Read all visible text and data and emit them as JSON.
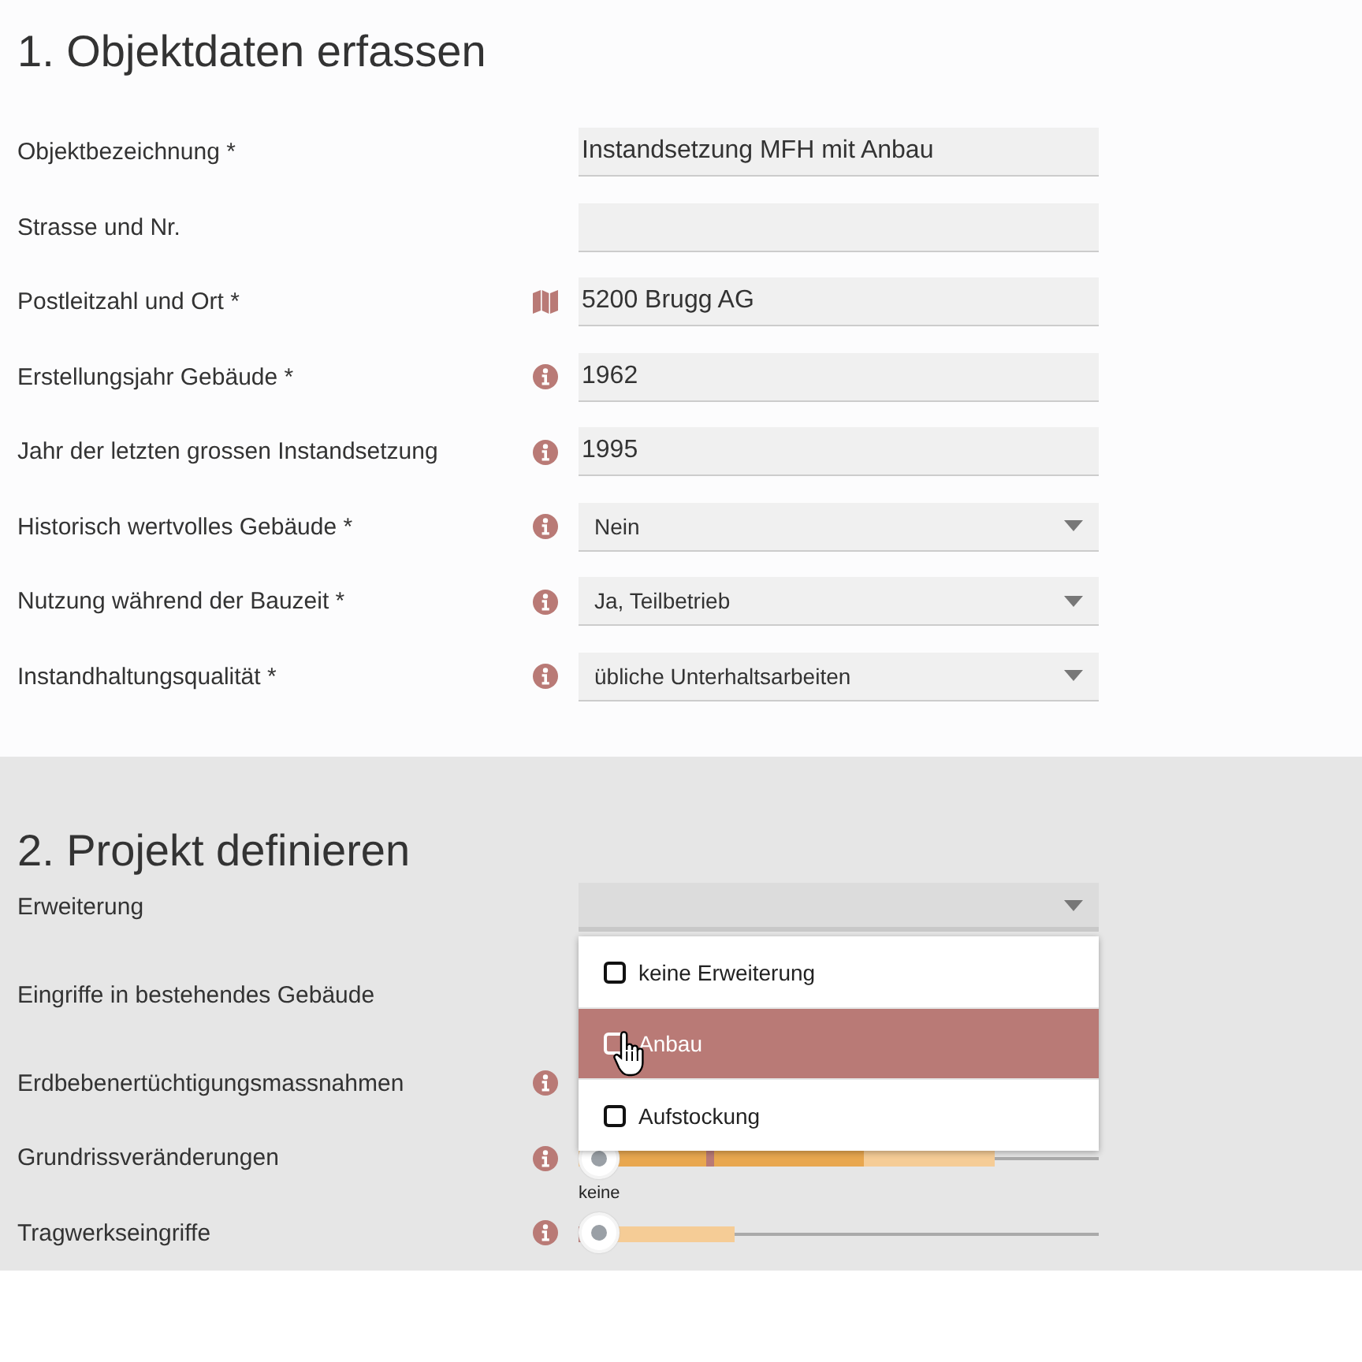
{
  "sections": [
    {
      "title": "1. Objektdaten erfassen",
      "rows": [
        {
          "label": "Objektbezeichnung *",
          "kind": "plain",
          "field": {
            "kind": "text",
            "value": "Instandsetzung MFH mit Anbau"
          }
        },
        {
          "label": "Strasse und Nr.",
          "kind": "plain",
          "field": {
            "kind": "text"
          }
        },
        {
          "label": "Postleitzahl und Ort *",
          "kind": "map",
          "field": {
            "kind": "text",
            "value": "5200 Brugg AG"
          }
        },
        {
          "label": "Erstellungsjahr Gebäude *",
          "kind": "info",
          "field": {
            "kind": "text",
            "value": "1962"
          }
        },
        {
          "label": "Jahr der letzten grossen Instandsetzung",
          "kind": "info",
          "field": {
            "kind": "text",
            "value": "1995"
          }
        },
        {
          "label": "Historisch wertvolles Gebäude *",
          "kind": "info",
          "field": {
            "kind": "select",
            "value": "Nein"
          }
        },
        {
          "label": "Nutzung während der Bauzeit *",
          "kind": "info",
          "field": {
            "kind": "select",
            "value": "Ja, Teilbetrieb"
          }
        },
        {
          "label": "Instandhaltungsqualität *",
          "kind": "info",
          "field": {
            "kind": "select",
            "value": "übliche Unterhaltsarbeiten"
          }
        }
      ]
    },
    {
      "title": "2. Projekt definieren",
      "rows": [
        {
          "label": "Erweiterung",
          "kind": "plain",
          "field": {
            "kind": "select",
            "expanded": true,
            "options": [
              {
                "label": "keine Erweiterung",
                "checked": false,
                "highlighted": false
              },
              {
                "label": "Anbau",
                "checked": false,
                "highlighted": true
              },
              {
                "label": "Aufstockung",
                "checked": false,
                "highlighted": false
              }
            ]
          }
        },
        {
          "label": "Eingriffe in bestehendes Gebäude",
          "kind": "plain",
          "field": {
            "kind": "covered"
          }
        },
        {
          "label": "Erdbebenertüchtigungsmassnahmen",
          "kind": "info",
          "field": {
            "kind": "covered"
          }
        },
        {
          "label": "Grundrissveränderungen",
          "kind": "info",
          "field": {
            "kind": "slider",
            "caption": "keine"
          }
        },
        {
          "label": "Tragwerkseingriffe",
          "kind": "info",
          "field": {
            "kind": "slider"
          }
        }
      ]
    }
  ]
}
